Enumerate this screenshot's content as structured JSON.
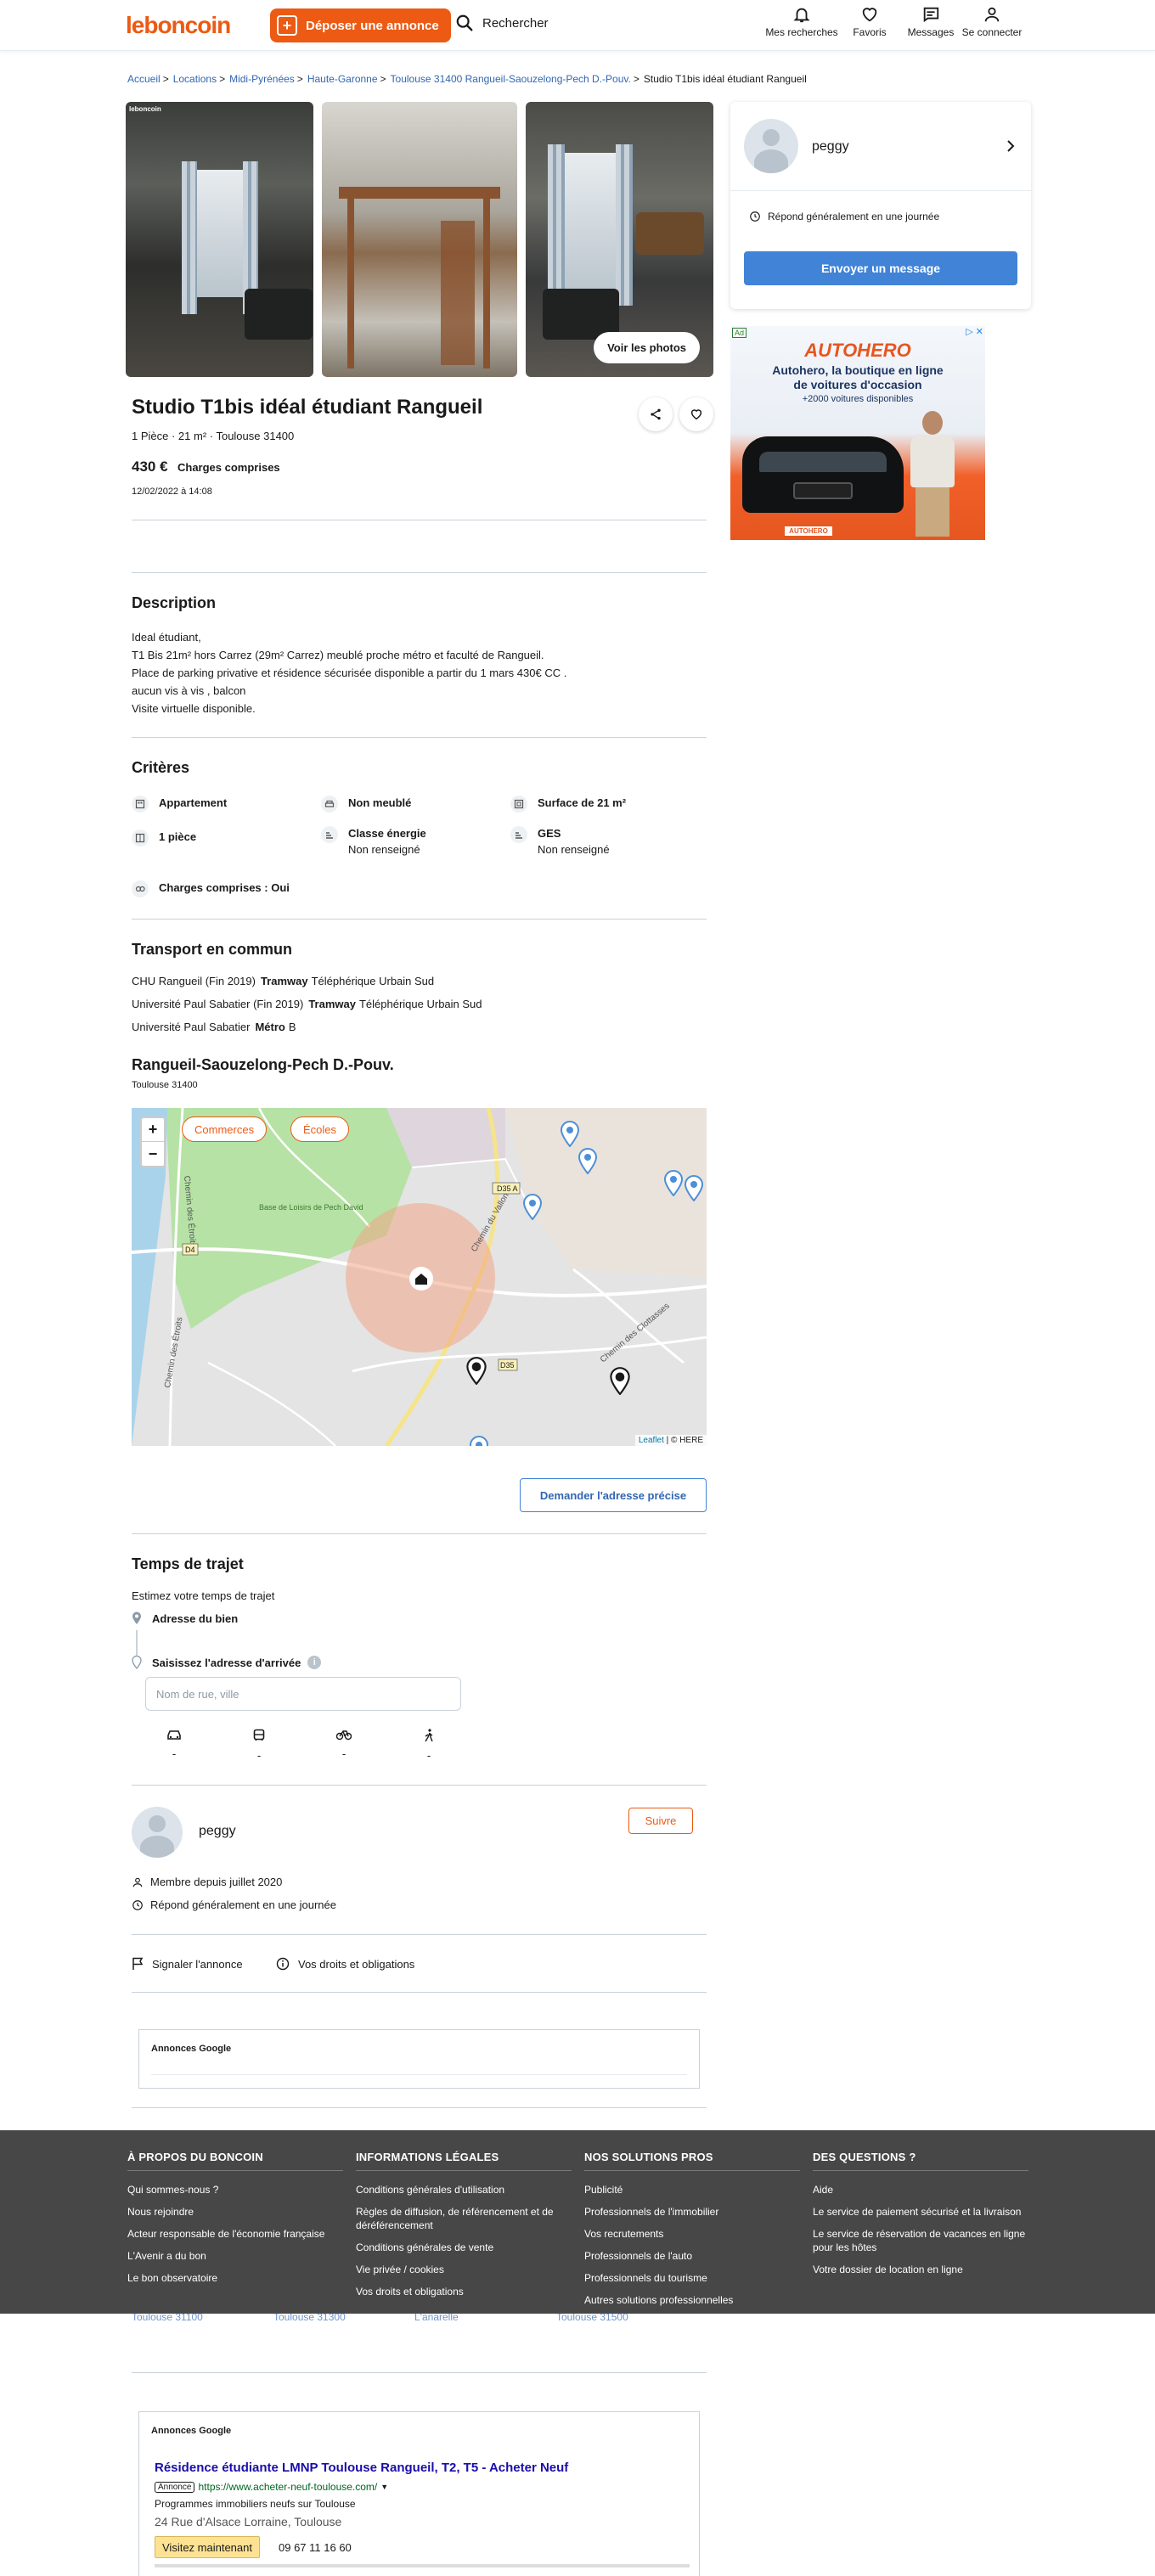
{
  "header": {
    "logo": "leboncoin",
    "deposit_label": "Déposer une annonce",
    "search_label": "Rechercher",
    "nav": [
      {
        "label": "Mes recherches",
        "icon": "bell-icon"
      },
      {
        "label": "Favoris",
        "icon": "heart-icon"
      },
      {
        "label": "Messages",
        "icon": "message-icon"
      },
      {
        "label": "Se connecter",
        "icon": "user-icon"
      }
    ]
  },
  "breadcrumb": {
    "items": [
      "Accueil",
      "Locations",
      "Midi-Pyrénées",
      "Haute-Garonne",
      "Toulouse 31400 Rangueil-Saouzelong-Pech D.-Pouv."
    ],
    "current": "Studio T1bis idéal étudiant Rangueil"
  },
  "photos": {
    "see_label": "Voir les photos",
    "photo_brand": "leboncoin"
  },
  "seller_card": {
    "name": "peggy",
    "respond_text": "Répond généralement en une journée",
    "message_button": "Envoyer un message"
  },
  "ad": {
    "tag": "Ad",
    "close": "▷ ✕",
    "brand": "AUTOHERO",
    "headline_1": "Autohero, la boutique en ligne",
    "headline_2": "de voitures d'occasion",
    "sub": "+2000 voitures disponibles",
    "plate": "AUTOHERO"
  },
  "listing": {
    "title": "Studio T1bis idéal étudiant Rangueil",
    "subline": "1 Pièce · 21 m² · Toulouse 31400",
    "price": "430 €",
    "price_note": "Charges comprises",
    "date": "12/02/2022 à 14:08"
  },
  "description": {
    "heading": "Description",
    "lines": [
      "Ideal étudiant,",
      "T1 Bis 21m² hors Carrez (29m² Carrez) meublé proche métro et faculté de Rangueil.",
      "Place de parking privative et résidence sécurisée disponible a partir du 1 mars 430€ CC .",
      "aucun vis à vis , balcon",
      "Visite virtuelle disponible."
    ]
  },
  "criteria": {
    "heading": "Critères",
    "items": [
      {
        "label": "Appartement",
        "value": ""
      },
      {
        "label": "Non meublé",
        "value": ""
      },
      {
        "label": "Surface de 21 m²",
        "value": ""
      },
      {
        "label": "1 pièce",
        "value": ""
      },
      {
        "label": "Classe énergie",
        "value": "Non renseigné"
      },
      {
        "label": "GES",
        "value": "Non renseigné"
      },
      {
        "label": "Charges comprises : Oui",
        "value": ""
      }
    ]
  },
  "transport": {
    "heading": "Transport en commun",
    "rows": [
      {
        "stop": "CHU Rangueil (Fin 2019)",
        "mode": "Tramway",
        "line": "Téléphérique Urbain Sud"
      },
      {
        "stop": "Université Paul Sabatier (Fin 2019)",
        "mode": "Tramway",
        "line": "Téléphérique Urbain Sud"
      },
      {
        "stop": "Université Paul Sabatier",
        "mode": "Métro",
        "line": "B"
      }
    ]
  },
  "location": {
    "title": "Rangueil-Saouzelong-Pech D.-Pouv.",
    "sub": "Toulouse 31400",
    "zoom_in": "+",
    "zoom_out": "−",
    "chip_shops": "Commerces",
    "chip_schools": "Écoles",
    "map_labels": {
      "park": "Base de Loisirs de Pech David",
      "road1": "Chemin du Vallon",
      "road2": "Chemin des Étroits",
      "road3": "Chemin des Étroits",
      "road4": "Chemin des Clottasses",
      "d35a": "D35 A",
      "d4": "D4",
      "d35": "D35"
    },
    "attribution_leaflet": "Leaflet",
    "attribution_rest": " | © HERE",
    "precise_button": "Demander l'adresse précise"
  },
  "travel": {
    "heading": "Temps de trajet",
    "estimate": "Estimez votre temps de trajet",
    "origin": "Adresse du bien",
    "dest_label": "Saisissez l'adresse d'arrivée",
    "placeholder": "Nom de rue, ville",
    "modes": [
      {
        "icon": "car-icon",
        "value": "-"
      },
      {
        "icon": "bus-icon",
        "value": "-"
      },
      {
        "icon": "bike-icon",
        "value": "-"
      },
      {
        "icon": "walk-icon",
        "value": "-"
      }
    ]
  },
  "seller": {
    "name": "peggy",
    "follow": "Suivre",
    "member_since": "Membre depuis juillet 2020",
    "respond": "Répond généralement en une journée"
  },
  "actions": {
    "report": "Signaler l'annonce",
    "rights": "Vos droits et obligations"
  },
  "google_ads": {
    "title": "Annonces Google",
    "title2": "Annonces Google",
    "ad_title": "Résidence étudiante LMNP Toulouse Rangueil, T2, T5 - Acheter Neuf",
    "ad_badge": "Annonce",
    "ad_url": "https://www.acheter-neuf-toulouse.com/",
    "ad_line1": "Programmes immobiliers neufs sur Toulouse",
    "ad_line2": "24 Rue d'Alsace Lorraine, Toulouse",
    "ad_cta": "Visitez maintenant",
    "ad_phone": "09 67 11 16 60"
  },
  "footer": {
    "cols": [
      {
        "title": "À PROPOS DU BONCOIN",
        "links": [
          "Qui sommes-nous ?",
          "Nous rejoindre",
          "Acteur responsable de l'économie française",
          "L'Avenir a du bon",
          "Le bon observatoire"
        ]
      },
      {
        "title": "INFORMATIONS LÉGALES",
        "links": [
          "Conditions générales d'utilisation",
          "Règles de diffusion, de référencement et de déréférencement",
          "Conditions générales de vente",
          "Vie privée / cookies",
          "Vos droits et obligations"
        ]
      },
      {
        "title": "NOS SOLUTIONS PROS",
        "links": [
          "Publicité",
          "Professionnels de l'immobilier",
          "Vos recrutements",
          "Professionnels de l'auto",
          "Professionnels du tourisme",
          "Autres solutions professionnelles"
        ]
      },
      {
        "title": "DES QUESTIONS ?",
        "links": [
          "Aide",
          "Le service de paiement sécurisé et la livraison",
          "Le service de réservation de vacances en ligne pour les hôtes",
          "Votre dossier de location en ligne"
        ]
      }
    ]
  },
  "ghost_cards": [
    "Toulouse 31100",
    "Toulouse 31300",
    "L'anarelle",
    "Toulouse 31500"
  ],
  "colors": {
    "brand": "#ec5a13",
    "link": "#3166b0",
    "primary_button": "#4183d7",
    "footer_bg": "#474747"
  }
}
